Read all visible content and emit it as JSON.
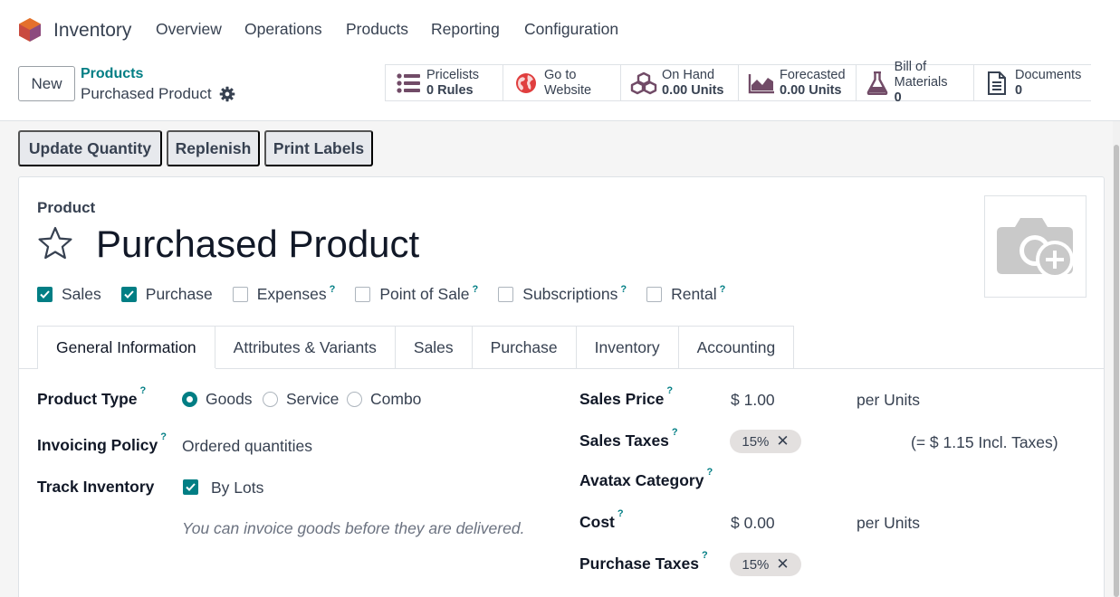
{
  "nav": {
    "app_name": "Inventory",
    "menu": [
      "Overview",
      "Operations",
      "Products",
      "Reporting",
      "Configuration"
    ]
  },
  "control_panel": {
    "new_label": "New",
    "breadcrumb_parent": "Products",
    "breadcrumb_current": "Purchased Product",
    "smart_buttons": [
      {
        "icon": "list-icon",
        "line1": "Pricelists",
        "line2": "0  Rules"
      },
      {
        "icon": "globe-icon",
        "line1": "Go to",
        "line2": "Website"
      },
      {
        "icon": "cubes-icon",
        "line1": "On Hand",
        "line2": "0.00 Units"
      },
      {
        "icon": "area-chart-icon",
        "line1": "Forecasted",
        "line2": "0.00 Units"
      },
      {
        "icon": "flask-icon",
        "line1": "Bill of Materials",
        "line2": "0"
      },
      {
        "icon": "document-icon",
        "line1": "Documents",
        "line2": "0"
      }
    ]
  },
  "actions": {
    "update_quantity": "Update Quantity",
    "replenish": "Replenish",
    "print_labels": "Print Labels"
  },
  "form": {
    "product_label": "Product",
    "product_name": "Purchased Product",
    "checkboxes": [
      {
        "label": "Sales",
        "checked": true,
        "help": false
      },
      {
        "label": "Purchase",
        "checked": true,
        "help": false
      },
      {
        "label": "Expenses",
        "checked": false,
        "help": true
      },
      {
        "label": "Point of Sale",
        "checked": false,
        "help": true
      },
      {
        "label": "Subscriptions",
        "checked": false,
        "help": true
      },
      {
        "label": "Rental",
        "checked": false,
        "help": true
      }
    ],
    "help_mark": "?",
    "tabs": [
      "General Information",
      "Attributes & Variants",
      "Sales",
      "Purchase",
      "Inventory",
      "Accounting"
    ],
    "left": {
      "product_type_label": "Product Type",
      "product_type_options": [
        "Goods",
        "Service",
        "Combo"
      ],
      "product_type_selected": "Goods",
      "invoicing_policy_label": "Invoicing Policy",
      "invoicing_policy_value": "Ordered quantities",
      "track_inventory_label": "Track Inventory",
      "track_inventory_checked": true,
      "track_inventory_value": "By Lots",
      "hint": "You can invoice goods before they are delivered."
    },
    "right": {
      "sales_price_label": "Sales Price",
      "sales_price_value": "$ 1.00",
      "sales_price_unit": "per Units",
      "sales_taxes_label": "Sales Taxes",
      "sales_taxes_tag": "15%",
      "sales_taxes_incl": "(= $ 1.15 Incl. Taxes)",
      "avatax_label": "Avatax Category",
      "cost_label": "Cost",
      "cost_value": "$ 0.00",
      "cost_unit": "per Units",
      "purchase_taxes_label": "Purchase Taxes",
      "purchase_taxes_tag": "15%"
    }
  },
  "colors": {
    "accent": "#017e84",
    "brand": "#714b67"
  }
}
